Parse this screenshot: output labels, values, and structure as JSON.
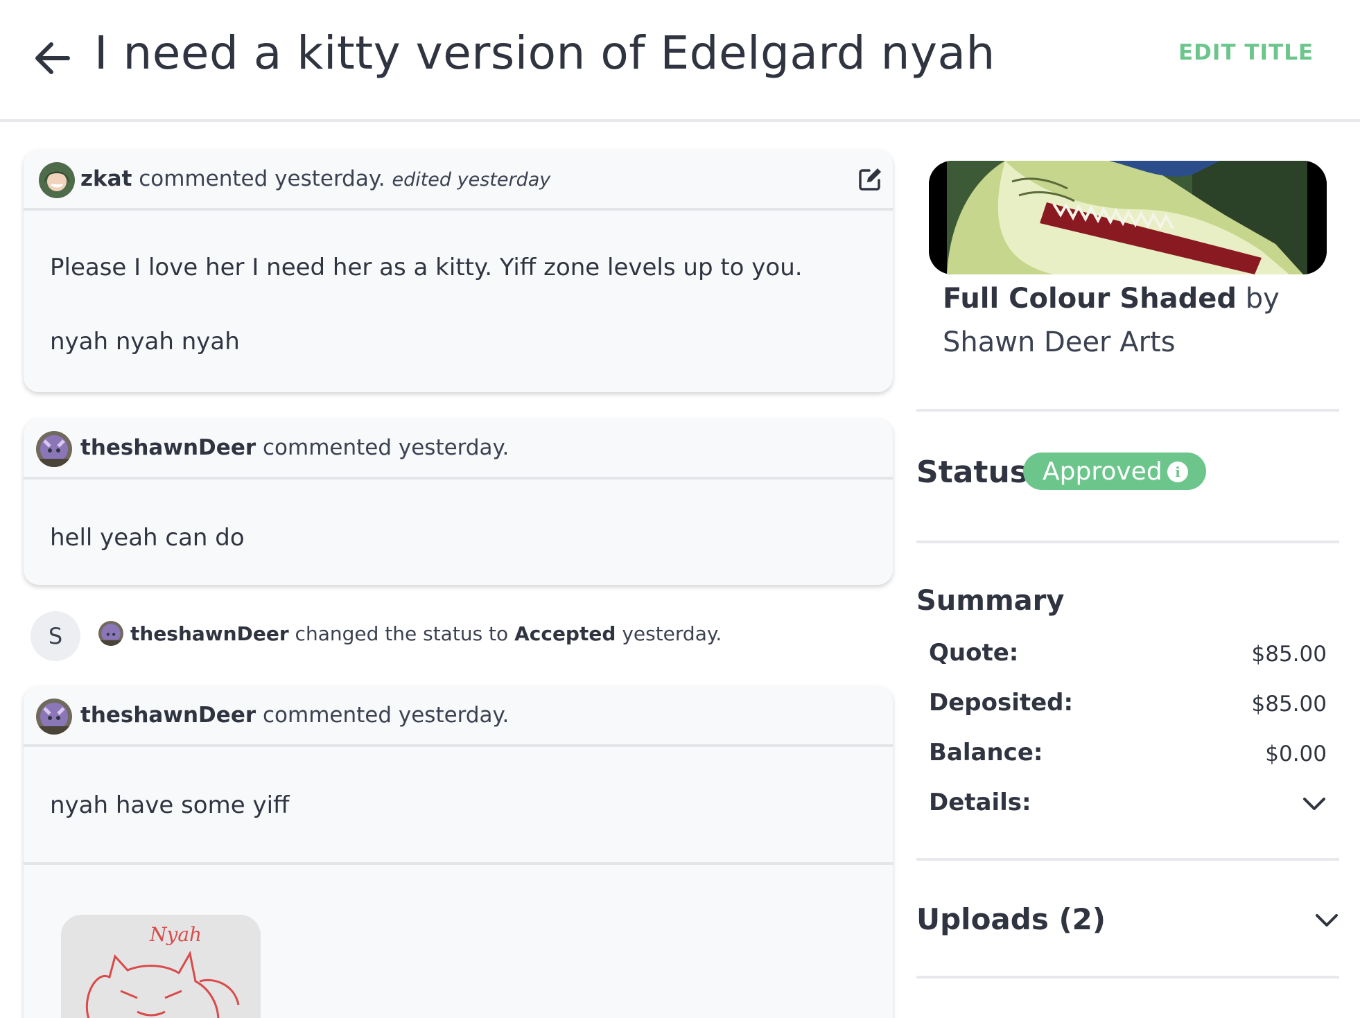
{
  "header": {
    "title": "I need a kitty version of Edelgard nyah",
    "edit_title": "EDIT TITLE"
  },
  "comments": [
    {
      "author": "zkat",
      "action": "commented yesterday.",
      "edited": "edited yesterday",
      "body": [
        "Please I love her I need her as a kitty. Yiff zone levels up to you.",
        "nyah nyah nyah"
      ]
    },
    {
      "author": "theshawnDeer",
      "action": "commented yesterday.",
      "body": [
        "hell yeah can do"
      ]
    },
    {
      "author": "theshawnDeer",
      "action": "commented yesterday.",
      "body": [
        "nyah have some yiff"
      ],
      "attachment_text": "Nyah"
    }
  ],
  "status_event": {
    "initial": "S",
    "author": "theshawnDeer",
    "text_before": "changed the status to",
    "status": "Accepted",
    "text_after": "yesterday."
  },
  "product": {
    "name": "Full Colour Shaded",
    "by": "by Shawn Deer Arts"
  },
  "status": {
    "label": "Status:",
    "value": "Approved",
    "info_glyph": "i",
    "badge_color": "#6cc68c"
  },
  "summary": {
    "title": "Summary",
    "rows": [
      {
        "label": "Quote:",
        "value": "$85.00"
      },
      {
        "label": "Deposited:",
        "value": "$85.00"
      },
      {
        "label": "Balance:",
        "value": "$0.00"
      },
      {
        "label": "Details:",
        "value": ""
      }
    ]
  },
  "uploads": {
    "title": "Uploads (2)"
  },
  "icons": {
    "back": "arrow-left-icon",
    "edit": "pencil-square-icon",
    "chevron": "chevron-down-icon",
    "info": "info-icon"
  },
  "colors": {
    "accent": "#6cc68c",
    "text": "#2f3440"
  }
}
